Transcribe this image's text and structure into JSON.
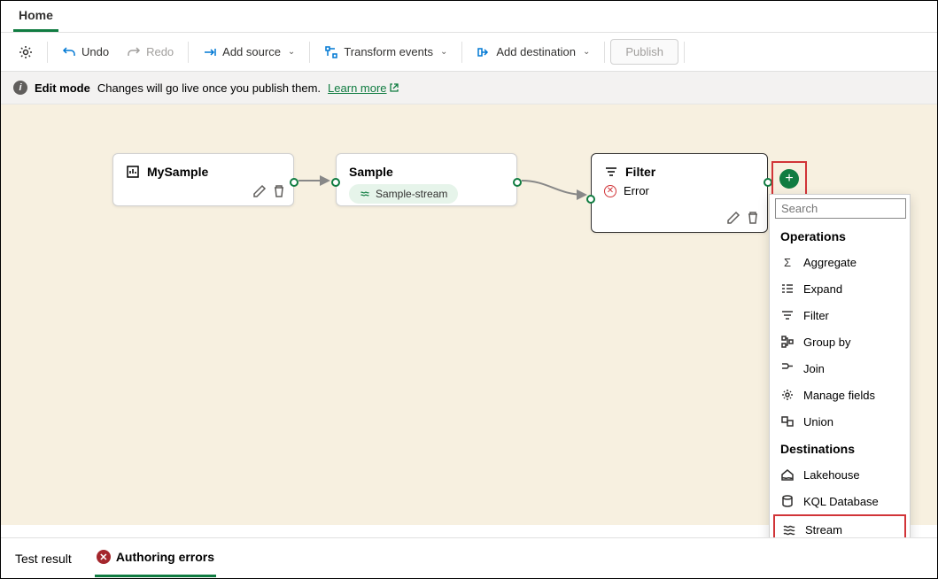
{
  "tabs": {
    "home": "Home"
  },
  "toolbar": {
    "undo": "Undo",
    "redo": "Redo",
    "add_source": "Add source",
    "transform": "Transform events",
    "add_dest": "Add destination",
    "publish": "Publish"
  },
  "info": {
    "mode": "Edit mode",
    "text": "Changes will go live once you publish them.",
    "link": "Learn more"
  },
  "nodes": {
    "source": {
      "title": "MySample"
    },
    "sample": {
      "title": "Sample",
      "stream": "Sample-stream"
    },
    "filter": {
      "title": "Filter",
      "error": "Error"
    }
  },
  "dropdown": {
    "search_placeholder": "Search",
    "ops_header": "Operations",
    "ops": {
      "aggregate": "Aggregate",
      "expand": "Expand",
      "filter": "Filter",
      "groupby": "Group by",
      "join": "Join",
      "manage": "Manage fields",
      "union": "Union"
    },
    "dest_header": "Destinations",
    "dest": {
      "lakehouse": "Lakehouse",
      "kql": "KQL Database",
      "stream": "Stream"
    }
  },
  "bottom": {
    "test": "Test result",
    "errors": "Authoring errors"
  }
}
